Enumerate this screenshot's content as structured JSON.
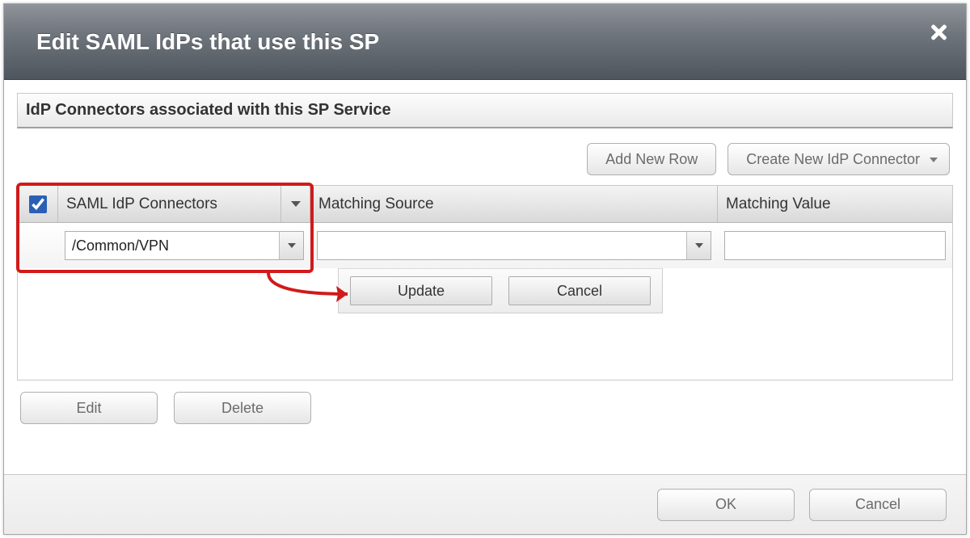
{
  "dialog": {
    "title": "Edit SAML IdPs that use this SP"
  },
  "section": {
    "heading": "IdP Connectors associated with this SP Service"
  },
  "actions": {
    "add_row": "Add New Row",
    "create_connector": "Create New IdP Connector"
  },
  "table": {
    "columns": {
      "connectors": "SAML IdP Connectors",
      "source": "Matching Source",
      "value": "Matching Value"
    },
    "header_checked": true,
    "row": {
      "connector_value": "/Common/VPN",
      "source_value": "",
      "value_value": ""
    }
  },
  "row_actions": {
    "update": "Update",
    "cancel": "Cancel"
  },
  "bottom": {
    "edit": "Edit",
    "delete": "Delete"
  },
  "footer": {
    "ok": "OK",
    "cancel": "Cancel"
  },
  "annotation": {
    "highlight": "connector-selection",
    "arrow_to": "update-button"
  }
}
